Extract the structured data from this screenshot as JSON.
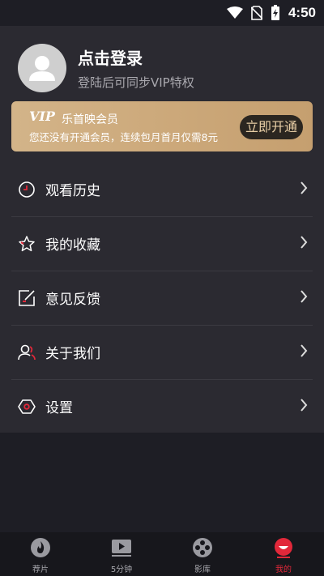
{
  "status_bar": {
    "time": "4:50",
    "icons": [
      "wifi-icon",
      "no-sim-icon",
      "battery-charging-icon"
    ]
  },
  "profile": {
    "title": "点击登录",
    "subtitle": "登陆后可同步VIP特权",
    "avatar_icon": "user-icon"
  },
  "vip_banner": {
    "logo": "VIP",
    "name": "乐首映会员",
    "description": "您还没有开通会员，连续包月首月仅需8元",
    "button_label": "立即开通",
    "colors": {
      "gold": "#cdaa7c",
      "button_bg": "#2b2620"
    }
  },
  "menu": [
    {
      "label": "观看历史",
      "icon": "clock-icon"
    },
    {
      "label": "我的收藏",
      "icon": "star-icon"
    },
    {
      "label": "意见反馈",
      "icon": "edit-icon"
    },
    {
      "label": "关于我们",
      "icon": "people-icon"
    },
    {
      "label": "设置",
      "icon": "settings-hexagon-icon"
    }
  ],
  "tab_bar": {
    "active_index": 3,
    "tabs": [
      {
        "label": "荐片",
        "icon": "flame-icon"
      },
      {
        "label": "5分钟",
        "icon": "play-video-icon"
      },
      {
        "label": "影库",
        "icon": "film-reel-icon"
      },
      {
        "label": "我的",
        "icon": "smiley-face-icon"
      }
    ]
  },
  "colors": {
    "background": "#1e1e25",
    "panel": "#2b2a31",
    "accent": "#e2283a"
  }
}
